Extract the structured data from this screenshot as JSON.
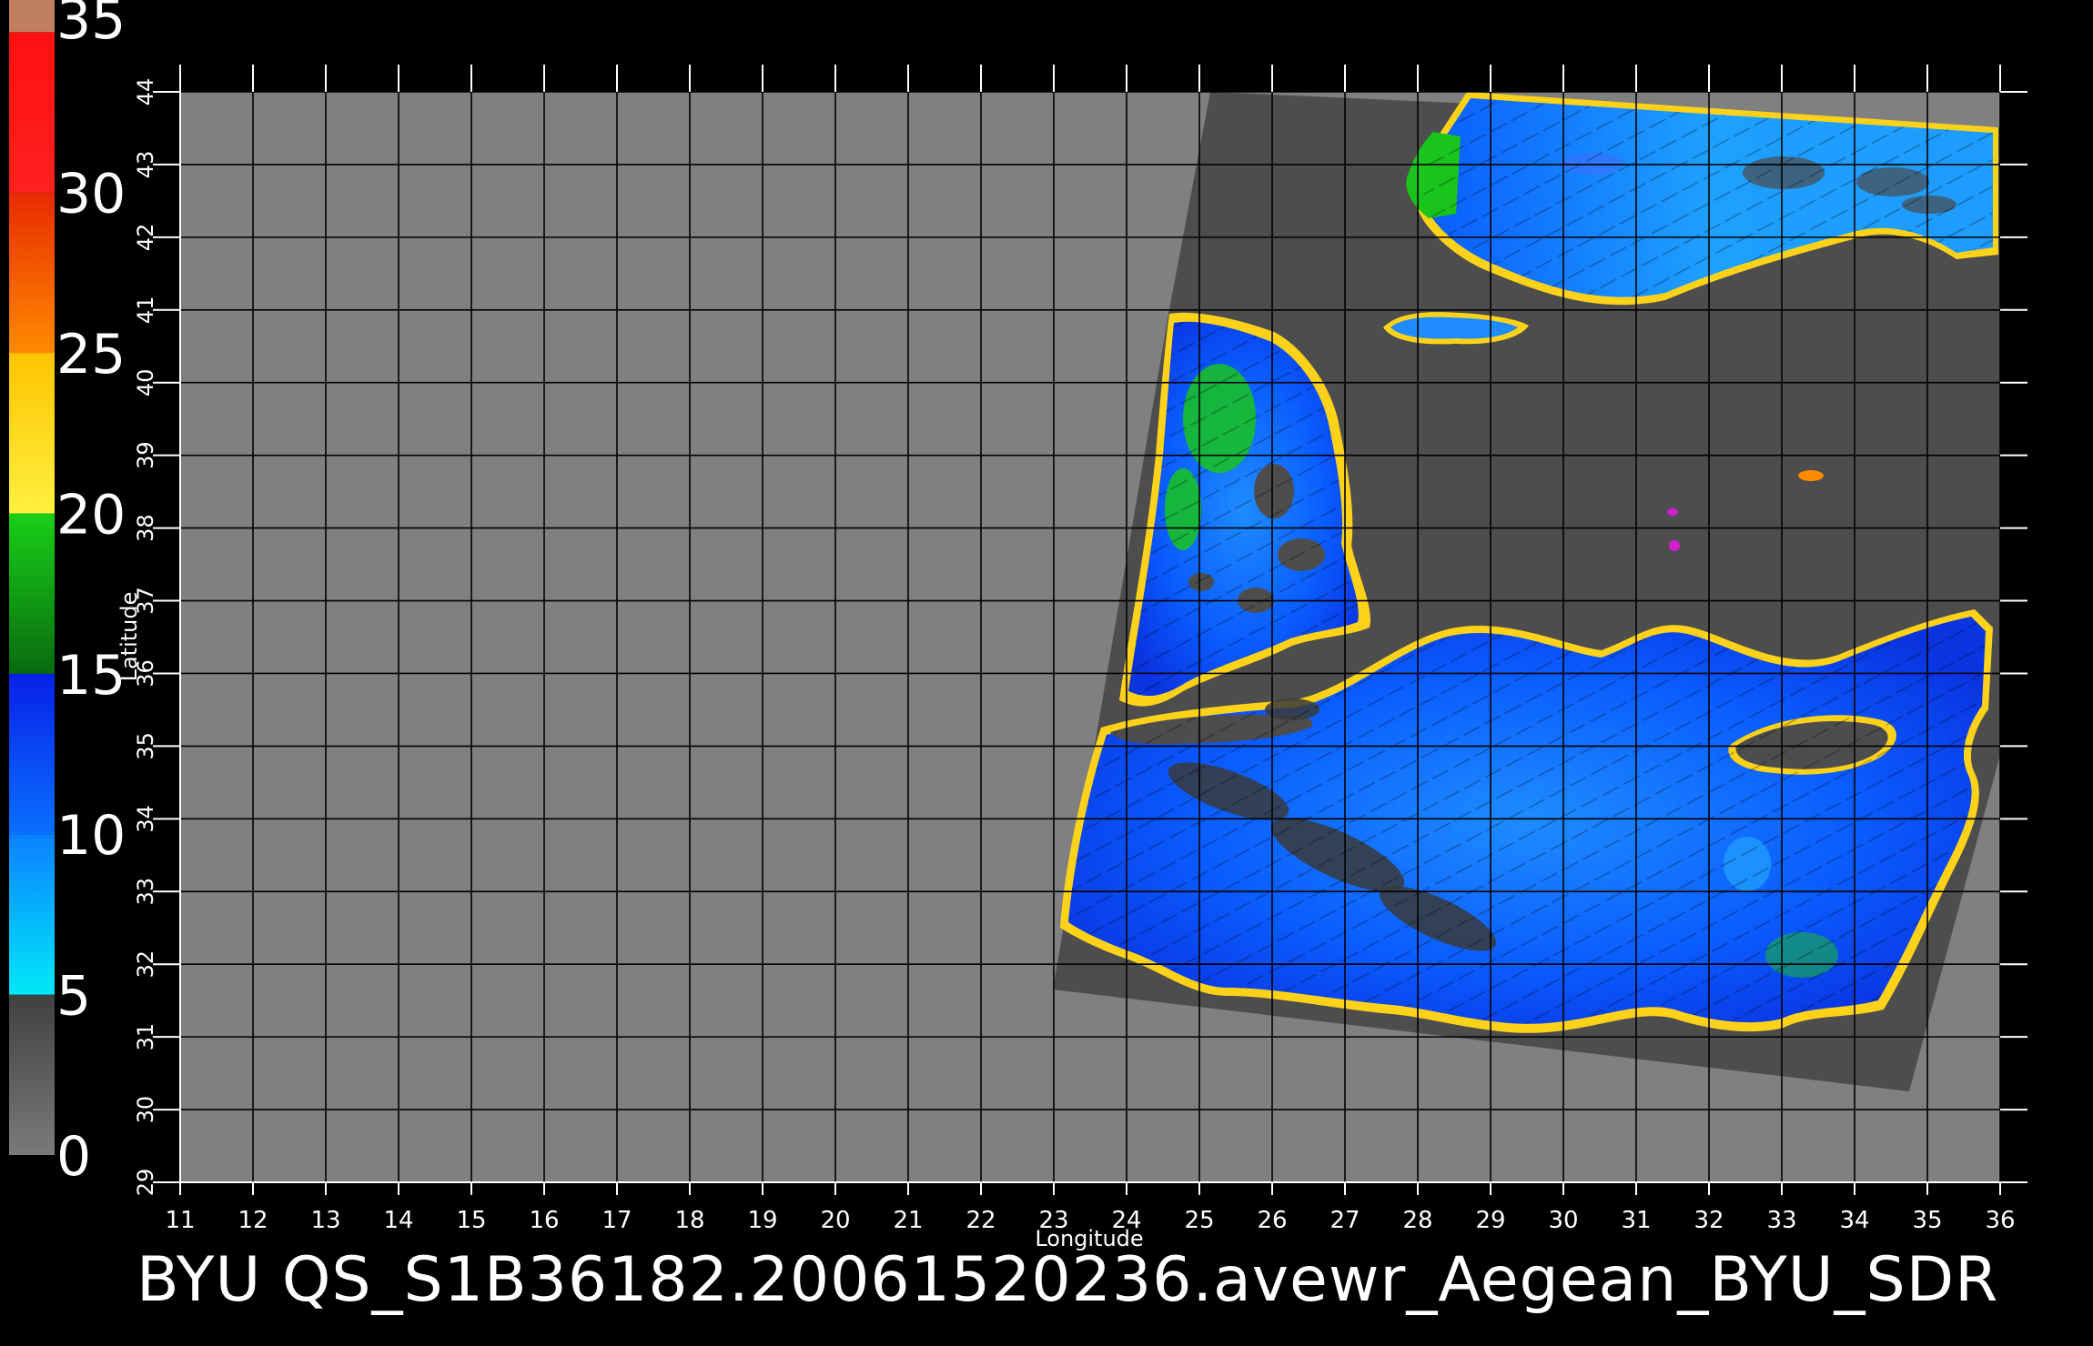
{
  "footer": {
    "title": "BYU  QS_S1B36182.20061520236.avewr_Aegean_BYU_SDR"
  },
  "colorbar": {
    "labels": [
      "35",
      "30",
      "25",
      "20",
      "15",
      "10",
      "5",
      "0"
    ],
    "segments": [
      {
        "from": 0,
        "to": 5,
        "colors": [
          "#7a7a7a",
          "#404040"
        ]
      },
      {
        "from": 5,
        "to": 10,
        "colors": [
          "#00e8f8",
          "#0a80ff"
        ]
      },
      {
        "from": 10,
        "to": 15,
        "colors": [
          "#0a70ff",
          "#0820e8"
        ]
      },
      {
        "from": 15,
        "to": 20,
        "colors": [
          "#0a6a10",
          "#18d018"
        ]
      },
      {
        "from": 20,
        "to": 25,
        "colors": [
          "#fff040",
          "#ffc400"
        ]
      },
      {
        "from": 25,
        "to": 30,
        "colors": [
          "#ff8a00",
          "#e82a00"
        ]
      },
      {
        "from": 30,
        "to": 35,
        "colors": [
          "#ff2020",
          "#ff1010"
        ]
      },
      {
        "from": 35,
        "to": 36,
        "colors": [
          "#c08060",
          "#c08060"
        ]
      }
    ]
  },
  "map": {
    "xlabel": "Longitude",
    "ylabel": "Latitude",
    "lon_ticks": [
      "11",
      "12",
      "13",
      "14",
      "15",
      "16",
      "17",
      "18",
      "19",
      "20",
      "21",
      "22",
      "23",
      "24",
      "25",
      "26",
      "27",
      "28",
      "29",
      "30",
      "31",
      "32",
      "33",
      "34",
      "35",
      "36"
    ],
    "lat_ticks": [
      "29",
      "30",
      "31",
      "32",
      "33",
      "34",
      "35",
      "36",
      "37",
      "38",
      "39",
      "40",
      "41",
      "42",
      "43",
      "44"
    ],
    "lon_range": [
      11,
      36
    ],
    "lat_range": [
      29,
      44
    ],
    "grid": true,
    "colors": {
      "background": "#000000",
      "no_data": "#808080",
      "land_swath": "#4d4d4d",
      "grid_line": "#000000",
      "wind_low": "#0a6cff",
      "wind_mid": "#1eaaff"
    }
  }
}
